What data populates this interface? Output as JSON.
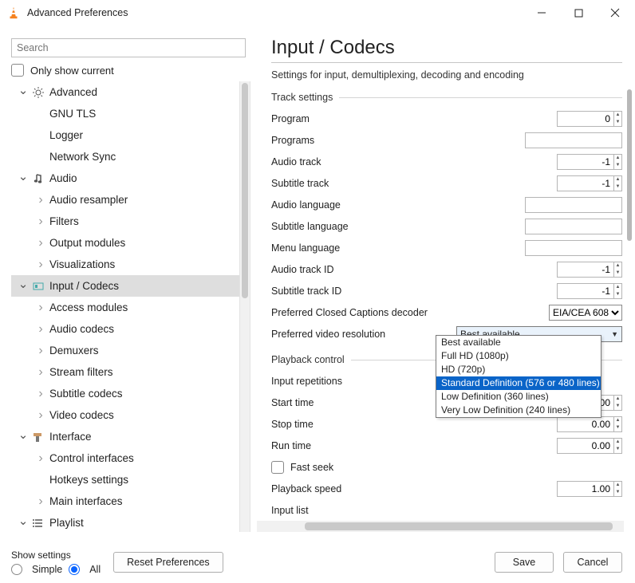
{
  "window": {
    "title": "Advanced Preferences"
  },
  "left": {
    "search_placeholder": "Search",
    "only_show_current": "Only show current"
  },
  "tree": [
    {
      "kind": "top",
      "arrow": "down",
      "icon": "gear",
      "label": "Advanced"
    },
    {
      "kind": "child",
      "arrow": "",
      "label": "GNU TLS"
    },
    {
      "kind": "child",
      "arrow": "",
      "label": "Logger"
    },
    {
      "kind": "child",
      "arrow": "",
      "label": "Network Sync"
    },
    {
      "kind": "top",
      "arrow": "down",
      "icon": "note",
      "label": "Audio"
    },
    {
      "kind": "child",
      "arrow": "right",
      "label": "Audio resampler"
    },
    {
      "kind": "child",
      "arrow": "right",
      "label": "Filters"
    },
    {
      "kind": "child",
      "arrow": "right",
      "label": "Output modules"
    },
    {
      "kind": "child",
      "arrow": "right",
      "label": "Visualizations"
    },
    {
      "kind": "top",
      "arrow": "down",
      "icon": "codec",
      "label": "Input / Codecs",
      "selected": true
    },
    {
      "kind": "child",
      "arrow": "right",
      "label": "Access modules"
    },
    {
      "kind": "child",
      "arrow": "right",
      "label": "Audio codecs"
    },
    {
      "kind": "child",
      "arrow": "right",
      "label": "Demuxers"
    },
    {
      "kind": "child",
      "arrow": "right",
      "label": "Stream filters"
    },
    {
      "kind": "child",
      "arrow": "right",
      "label": "Subtitle codecs"
    },
    {
      "kind": "child",
      "arrow": "right",
      "label": "Video codecs"
    },
    {
      "kind": "top",
      "arrow": "down",
      "icon": "brush",
      "label": "Interface"
    },
    {
      "kind": "child",
      "arrow": "right",
      "label": "Control interfaces"
    },
    {
      "kind": "child",
      "arrow": "",
      "label": "Hotkeys settings"
    },
    {
      "kind": "child",
      "arrow": "right",
      "label": "Main interfaces"
    },
    {
      "kind": "top",
      "arrow": "down",
      "icon": "list",
      "label": "Playlist"
    }
  ],
  "page": {
    "title": "Input / Codecs",
    "subtitle": "Settings for input, demultiplexing, decoding and encoding",
    "section_track": "Track settings",
    "section_playback": "Playback control",
    "labels": {
      "program": "Program",
      "programs": "Programs",
      "audio_track": "Audio track",
      "subtitle_track": "Subtitle track",
      "audio_language": "Audio language",
      "subtitle_language": "Subtitle language",
      "menu_language": "Menu language",
      "audio_track_id": "Audio track ID",
      "subtitle_track_id": "Subtitle track ID",
      "cc_decoder": "Preferred Closed Captions decoder",
      "video_res": "Preferred video resolution",
      "input_rep": "Input repetitions",
      "start_time": "Start time",
      "stop_time": "Stop time",
      "run_time": "Run time",
      "fast_seek": "Fast seek",
      "playback_speed": "Playback speed",
      "input_list": "Input list"
    },
    "values": {
      "program": "0",
      "programs": "",
      "audio_track": "-1",
      "subtitle_track": "-1",
      "audio_language": "",
      "subtitle_language": "",
      "menu_language": "",
      "audio_track_id": "-1",
      "subtitle_track_id": "-1",
      "cc_decoder": "EIA/CEA 608",
      "video_res": "Best available",
      "start_time": "0.00",
      "stop_time": "0.00",
      "run_time": "0.00",
      "playback_speed": "1.00"
    },
    "video_res_options": [
      "Best available",
      "Full HD (1080p)",
      "HD (720p)",
      "Standard Definition (576 or 480 lines)",
      "Low Definition (360 lines)",
      "Very Low Definition (240 lines)"
    ],
    "video_res_highlight": 3
  },
  "footer": {
    "show_settings": "Show settings",
    "simple": "Simple",
    "all": "All",
    "reset": "Reset Preferences",
    "save": "Save",
    "cancel": "Cancel"
  }
}
